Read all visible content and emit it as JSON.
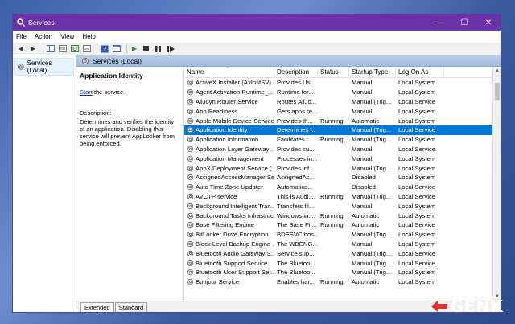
{
  "window": {
    "title": "Services"
  },
  "menu": [
    "File",
    "Action",
    "View",
    "Help"
  ],
  "tree": {
    "item": "Services (Local)"
  },
  "main_header": "Services (Local)",
  "details": {
    "service_name": "Application Identity",
    "action_link": "Start",
    "action_rest": " the service",
    "desc_label": "Description:",
    "desc_text": "Determines and verifies the identity of an application. Disabling this service will prevent AppLocker from being enforced."
  },
  "columns": {
    "name": "Name",
    "description": "Description",
    "status": "Status",
    "startup": "Startup Type",
    "logon": "Log On As"
  },
  "services": [
    {
      "name": "ActiveX Installer (AxInstSV)",
      "desc": "Provides Us...",
      "status": "",
      "startup": "Manual",
      "logon": "Local System"
    },
    {
      "name": "Agent Activation Runtime_...",
      "desc": "Runtime for...",
      "status": "",
      "startup": "Manual",
      "logon": "Local System"
    },
    {
      "name": "AllJoyn Router Service",
      "desc": "Routes AllJo...",
      "status": "",
      "startup": "Manual (Trig...",
      "logon": "Local Service"
    },
    {
      "name": "App Readiness",
      "desc": "Gets apps re...",
      "status": "",
      "startup": "Manual",
      "logon": "Local System"
    },
    {
      "name": "Apple Mobile Device Service",
      "desc": "Provides th...",
      "status": "Running",
      "startup": "Automatic",
      "logon": "Local System"
    },
    {
      "name": "Application Identity",
      "desc": "Determines ...",
      "status": "",
      "startup": "Manual (Trig...",
      "logon": "Local Service",
      "selected": true
    },
    {
      "name": "Application Information",
      "desc": "Facilitates t...",
      "status": "Running",
      "startup": "Manual (Trig...",
      "logon": "Local System"
    },
    {
      "name": "Application Layer Gateway ...",
      "desc": "Provides su...",
      "status": "",
      "startup": "Manual",
      "logon": "Local Service"
    },
    {
      "name": "Application Management",
      "desc": "Processes in...",
      "status": "",
      "startup": "Manual",
      "logon": "Local System"
    },
    {
      "name": "AppX Deployment Service (...",
      "desc": "Provides inf...",
      "status": "",
      "startup": "Manual (Trig...",
      "logon": "Local System"
    },
    {
      "name": "AssignedAccessManager Se...",
      "desc": "AssignedAc...",
      "status": "",
      "startup": "Disabled",
      "logon": "Local System"
    },
    {
      "name": "Auto Time Zone Updater",
      "desc": "Automatica...",
      "status": "",
      "startup": "Disabled",
      "logon": "Local Service"
    },
    {
      "name": "AVCTP service",
      "desc": "This is Audi...",
      "status": "Running",
      "startup": "Manual (Trig...",
      "logon": "Local Service"
    },
    {
      "name": "Background Intelligent Tran...",
      "desc": "Transfers fil...",
      "status": "",
      "startup": "Manual",
      "logon": "Local System"
    },
    {
      "name": "Background Tasks Infrastruc...",
      "desc": "Windows in...",
      "status": "Running",
      "startup": "Automatic",
      "logon": "Local System"
    },
    {
      "name": "Base Filtering Engine",
      "desc": "The Base Fil...",
      "status": "Running",
      "startup": "Automatic",
      "logon": "Local Service"
    },
    {
      "name": "BitLocker Drive Encryption ...",
      "desc": "BDESVC hos...",
      "status": "",
      "startup": "Manual (Trig...",
      "logon": "Local System"
    },
    {
      "name": "Block Level Backup Engine ...",
      "desc": "The WBENG...",
      "status": "",
      "startup": "Manual",
      "logon": "Local System"
    },
    {
      "name": "Bluetooth Audio Gateway S...",
      "desc": "Service sup...",
      "status": "",
      "startup": "Manual (Trig...",
      "logon": "Local Service"
    },
    {
      "name": "Bluetooth Support Service",
      "desc": "The Bluetoo...",
      "status": "",
      "startup": "Manual (Trig...",
      "logon": "Local Service"
    },
    {
      "name": "Bluetooth User Support Ser...",
      "desc": "The Bluetoo...",
      "status": "",
      "startup": "Manual (Trig...",
      "logon": "Local System"
    },
    {
      "name": "Bonjour Service",
      "desc": "Enables har...",
      "status": "Running",
      "startup": "Automatic",
      "logon": "Local System"
    }
  ],
  "tabs": [
    "Extended",
    "Standard"
  ],
  "logo": "GENK"
}
